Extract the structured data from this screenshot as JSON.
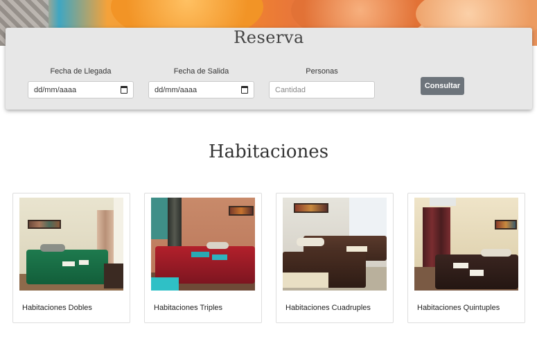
{
  "reserva": {
    "title": "Reserva",
    "fields": [
      {
        "label": "Fecha de Llegada",
        "value": "dd/mm/aaaa"
      },
      {
        "label": "Fecha de Salida",
        "value": "dd/mm/aaaa"
      },
      {
        "label": "Personas",
        "placeholder": "Cantidad"
      }
    ],
    "button_label": "Consultar"
  },
  "habitaciones": {
    "title": "Habitaciones",
    "cards": [
      {
        "caption": "Habitaciones Dobles"
      },
      {
        "caption": "Habitaciones Triples"
      },
      {
        "caption": "Habitaciones Cuadruples"
      },
      {
        "caption": "Habitaciones Quintuples"
      }
    ]
  },
  "icons": [
    "calendar-icon"
  ],
  "colors": {
    "panel": "#e7e7e7",
    "button": "#6d747b"
  }
}
